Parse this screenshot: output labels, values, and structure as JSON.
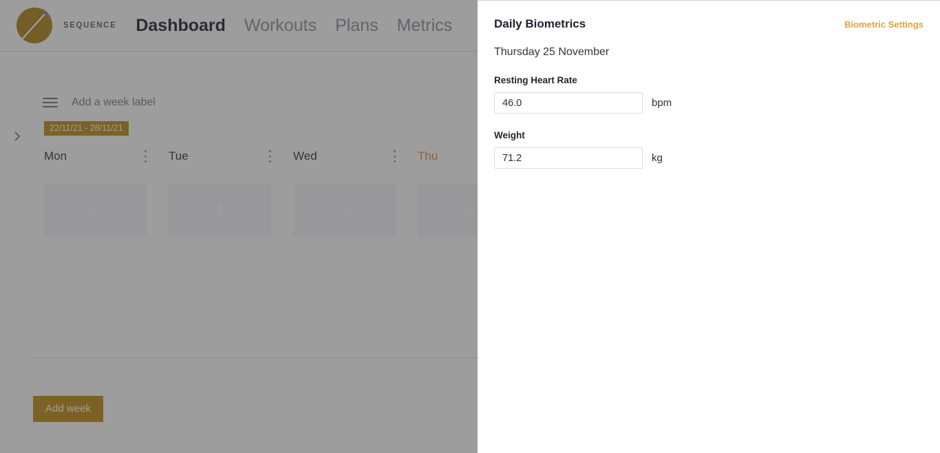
{
  "app": {
    "brand": {
      "wordmark": "SEQUENCE",
      "logo_icon": "sequence-s-logo",
      "logo_color": "#a8800f"
    },
    "nav": {
      "items": [
        {
          "label": "Dashboard",
          "active": true
        },
        {
          "label": "Workouts",
          "active": false
        },
        {
          "label": "Plans",
          "active": false
        },
        {
          "label": "Metrics",
          "active": false
        }
      ]
    },
    "planner": {
      "expand_icon": "chevron-right-icon",
      "drag_handle_icon": "hamburger-drag-icon",
      "week_label_placeholder": "Add a week label",
      "week_range": "22/11/21 - 28/11/21",
      "week_range_color": "#bd8b0d",
      "days": [
        {
          "name": "Mon",
          "today": false,
          "menu_icon": "kebab-menu-icon",
          "add_icon": "plus-icon"
        },
        {
          "name": "Tue",
          "today": false,
          "menu_icon": "kebab-menu-icon",
          "add_icon": "plus-icon"
        },
        {
          "name": "Wed",
          "today": false,
          "menu_icon": "kebab-menu-icon",
          "add_icon": "plus-icon"
        },
        {
          "name": "Thu",
          "today": true,
          "menu_icon": "kebab-menu-icon",
          "add_icon": "plus-icon"
        }
      ],
      "today_color": "#d4900f",
      "add_week_label": "Add week",
      "add_week_color": "#bd8b0d"
    }
  },
  "panel": {
    "title": "Daily Biometrics",
    "settings_link": "Biometric Settings",
    "settings_link_color": "#e0a33e",
    "date": "Thursday 25 November",
    "fields": [
      {
        "label": "Resting Heart Rate",
        "value": "46.0",
        "placeholder": "",
        "unit": "bpm"
      },
      {
        "label": "Weight",
        "value": "71.2",
        "placeholder": "",
        "unit": "kg"
      }
    ]
  }
}
